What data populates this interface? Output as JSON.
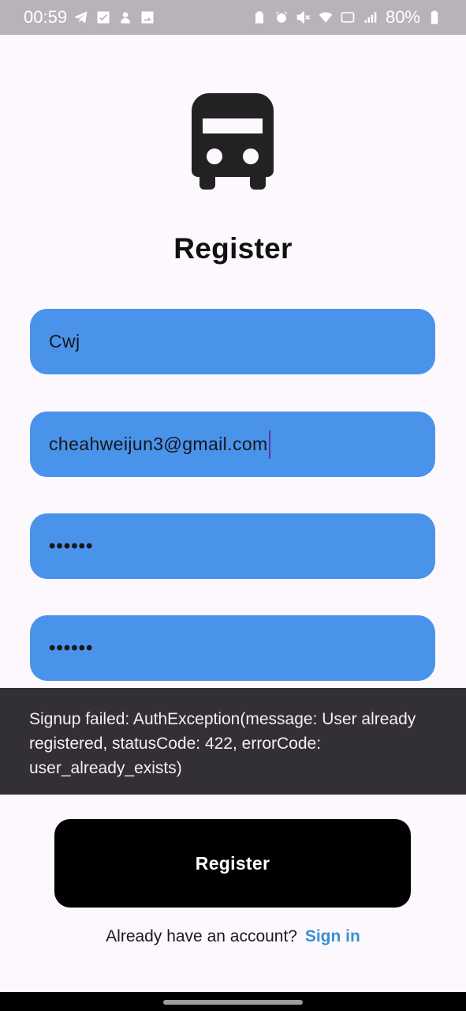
{
  "status_bar": {
    "time": "00:59",
    "battery": "80%",
    "left_icons": [
      "telegram-icon",
      "check-square-icon",
      "notification-app-icon",
      "image-icon"
    ],
    "right_icons": [
      "battery-saver-icon",
      "alarm-icon",
      "mute-icon",
      "wifi-icon",
      "volte-icon",
      "signal-icon",
      "battery-icon"
    ]
  },
  "logo": {
    "icon": "bus-icon"
  },
  "title": "Register",
  "form": {
    "name_value": "Cwj",
    "email_value": "cheahweijun3@gmail.com",
    "password_value": "••••••",
    "confirm_password_value": "••••••"
  },
  "snackbar": {
    "message": "Signup failed: AuthException(message: User already registered, statusCode: 422, errorCode: user_already_exists)"
  },
  "register_button": {
    "label": "Register"
  },
  "signin": {
    "prompt": "Already have an account?",
    "link": "Sign in"
  },
  "colors": {
    "field_bg": "#4a93ea",
    "button_bg": "#000000",
    "link": "#3b8fd4",
    "snackbar_bg": "#322f35"
  }
}
